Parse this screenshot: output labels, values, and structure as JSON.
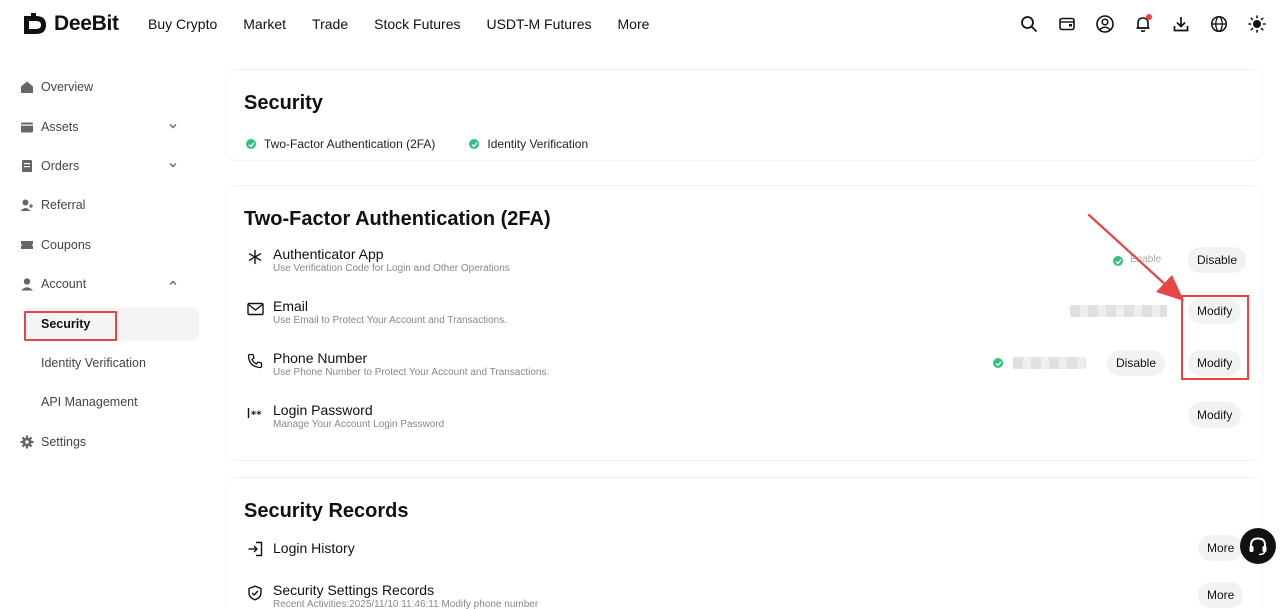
{
  "brand": {
    "name": "DeeBit"
  },
  "nav": [
    {
      "label": "Buy Crypto"
    },
    {
      "label": "Market"
    },
    {
      "label": "Trade"
    },
    {
      "label": "Stock Futures"
    },
    {
      "label": "USDT-M Futures"
    },
    {
      "label": "More"
    }
  ],
  "header_icons": [
    "search-icon",
    "wallet-icon",
    "user-icon",
    "bell-icon",
    "download-icon",
    "globe-icon",
    "theme-sun-icon"
  ],
  "sidebar": {
    "items": [
      {
        "label": "Overview",
        "icon": "home-icon"
      },
      {
        "label": "Assets",
        "icon": "wallet-icon"
      },
      {
        "label": "Orders",
        "icon": "orders-icon"
      },
      {
        "label": "Referral",
        "icon": "referral-icon"
      },
      {
        "label": "Coupons",
        "icon": "coupon-icon"
      },
      {
        "label": "Account",
        "icon": "user-icon"
      }
    ],
    "account_sub": [
      {
        "label": "Security"
      },
      {
        "label": "Identity Verification"
      },
      {
        "label": "API Management"
      }
    ],
    "settings": {
      "label": "Settings",
      "icon": "gear-icon"
    }
  },
  "security_card": {
    "title": "Security",
    "statuses": [
      {
        "label": "Two-Factor Authentication (2FA)"
      },
      {
        "label": "Identity Verification"
      }
    ]
  },
  "twofa_card": {
    "title": "Two-Factor Authentication (2FA)",
    "rows": [
      {
        "title": "Authenticator App",
        "subtitle": "Use Verification Code for Login and Other Operations",
        "status": "Enable",
        "action": "Disable"
      },
      {
        "title": "Email",
        "subtitle": "Use Email to Protect Your Account and Transactions.",
        "action": "Modify"
      },
      {
        "title": "Phone Number",
        "subtitle": "Use Phone Number to Protect Your Account and Transactions.",
        "action_disable": "Disable",
        "action": "Modify"
      },
      {
        "title": "Login Password",
        "subtitle": "Manage Your Account Login Password",
        "action": "Modify"
      }
    ]
  },
  "records_card": {
    "title": "Security Records",
    "rows": [
      {
        "title": "Login History",
        "action": "More"
      },
      {
        "title": "Security Settings Records",
        "subtitle": "Recent Activities:2025/11/10 11:46:11 Modify phone number",
        "action": "More"
      }
    ]
  },
  "colors": {
    "accent_green": "#33c27e",
    "annotation_red": "#e64545",
    "notification_red": "#f0433a"
  }
}
